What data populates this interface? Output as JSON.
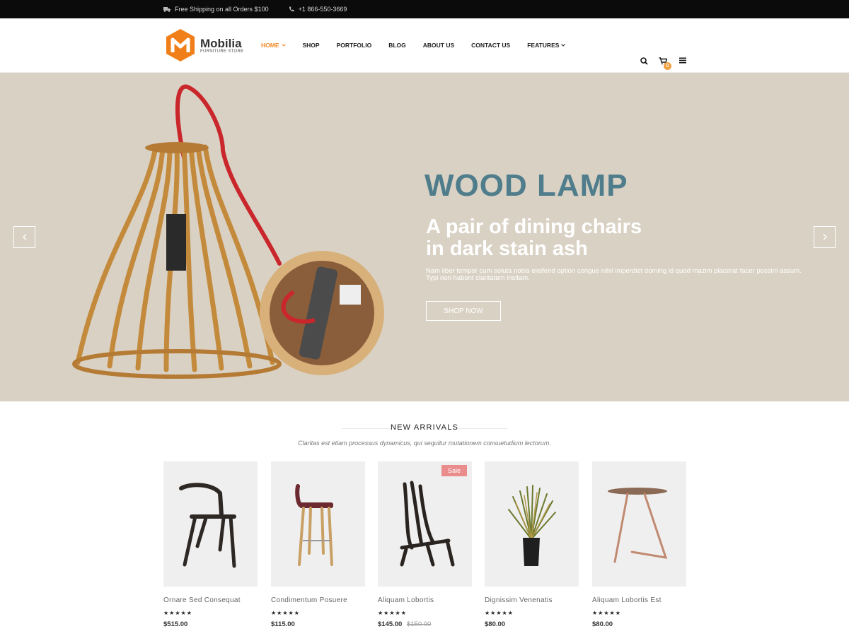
{
  "topbar": {
    "shipping": "Free Shipping on all Orders $100",
    "phone": "+1 866-550-3669"
  },
  "logo": {
    "name": "Mobilia",
    "tagline": "FURNITURE STORE",
    "color": "#f07f1a"
  },
  "nav": {
    "items": [
      {
        "label": "HOME",
        "active": true,
        "dropdown": true
      },
      {
        "label": "SHOP"
      },
      {
        "label": "PORTFOLIO"
      },
      {
        "label": "BLOG"
      },
      {
        "label": "ABOUT US"
      },
      {
        "label": "CONTACT US"
      },
      {
        "label": "FEATURES",
        "dropdown": true
      }
    ],
    "accent": "#f08a24"
  },
  "header_icons": {
    "search": "search-icon",
    "cart": "cart-icon",
    "cart_count": "0",
    "menu": "menu-icon"
  },
  "hero": {
    "title": "WOOD LAMP",
    "subtitle_line1": "A pair of dining chairs",
    "subtitle_line2": "in dark stain ash",
    "text": "Nam liber tempor cum soluta nobis eleifend option congue nihil imperdiet doming id quod mazim placerat facer possim assum. Typi non habent claritatem insitam.",
    "button": "SHOP NOW",
    "bg_color": "#d9d1c4",
    "title_color": "#4f7d8c"
  },
  "arrivals": {
    "title": "NEW ARRIVALS",
    "subtitle": "Claritas est etiam processus dynamicus, qui sequitur mutationem consuetudium lectorum.",
    "products": [
      {
        "name": "Ornare Sed Consequat",
        "price": "$515.00",
        "rating": "★★★★★"
      },
      {
        "name": "Condimentum Posuere",
        "price": "$115.00",
        "rating": "★★★★★"
      },
      {
        "name": "Aliquam Lobortis",
        "price": "$145.00",
        "old_price": "$150.00",
        "badge": "Sale",
        "rating": "★★★★★"
      },
      {
        "name": "Dignissim Venenatis",
        "price": "$80.00",
        "rating": "★★★★★"
      },
      {
        "name": "Aliquam Lobortis Est",
        "price": "$80.00",
        "rating": "★★★★★"
      }
    ]
  }
}
